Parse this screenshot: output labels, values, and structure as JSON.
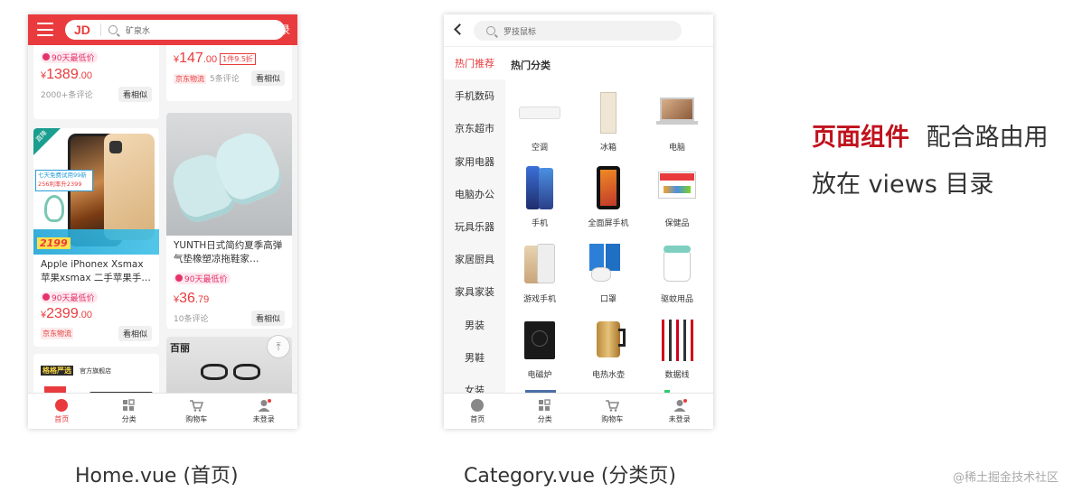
{
  "home": {
    "header": {
      "logo": "JD",
      "search_placeholder": "矿泉水",
      "login": "登录"
    },
    "cards": {
      "top_left": {
        "tag": "90天最低价",
        "price_cur": "¥",
        "price_int": "1389",
        "price_dec": ".00",
        "reviews": "2000+条评论",
        "similar": "看相似"
      },
      "top_right": {
        "price_cur": "¥",
        "price_int": "147",
        "price_dec": ".00",
        "discount": "1件9.5折",
        "logistics": "京东物流",
        "reviews": "5条评论",
        "similar": "看相似"
      },
      "iphone": {
        "corner": "直降",
        "promo": "七天免费试用99新",
        "promo2": "256利率升2399",
        "price_tag": "2199",
        "title": "Apple iPhonex Xsmax苹果xsmax 二手苹果手…",
        "tag": "90天最低价",
        "price_cur": "¥",
        "price_int": "2399",
        "price_dec": ".00",
        "logistics": "京东物流",
        "similar": "看相似"
      },
      "slippers": {
        "title": "YUNTH日式简约夏季高弹气垫橡塑凉拖鞋家…",
        "tag": "90天最低价",
        "price_cur": "¥",
        "price_int": "36",
        "price_dec": ".79",
        "reviews": "10条评论",
        "similar": "看相似"
      },
      "bottom_left": {
        "brand": "格格严选",
        "store": "官方旗舰店"
      },
      "bottom_right": {
        "brand": "百丽"
      }
    },
    "totop_icon": "top-arrow-icon",
    "tabbar": [
      {
        "label": "首页",
        "icon": "home-icon"
      },
      {
        "label": "分类",
        "icon": "category-icon"
      },
      {
        "label": "购物车",
        "icon": "cart-icon"
      },
      {
        "label": "未登录",
        "icon": "user-icon"
      }
    ]
  },
  "category": {
    "header": {
      "search_placeholder": "罗技鼠标"
    },
    "sidebar": [
      "热门推荐",
      "手机数码",
      "京东超市",
      "家用电器",
      "电脑办公",
      "玩具乐器",
      "家居厨具",
      "家具家装",
      "男装",
      "男鞋",
      "女装"
    ],
    "section_title": "热门分类",
    "items": [
      "空调",
      "冰箱",
      "电脑",
      "手机",
      "全面屏手机",
      "保健品",
      "游戏手机",
      "口罩",
      "驱蚊用品",
      "电磁炉",
      "电热水壶",
      "数据线"
    ],
    "tabbar": [
      {
        "label": "首页",
        "icon": "home-icon"
      },
      {
        "label": "分类",
        "icon": "category-icon"
      },
      {
        "label": "购物车",
        "icon": "cart-icon"
      },
      {
        "label": "未登录",
        "icon": "user-icon"
      }
    ]
  },
  "captions": {
    "home": "Home.vue (首页)",
    "category": "Category.vue (分类页)"
  },
  "side_text": {
    "highlight": "页面组件",
    "rest1": "配合路由用",
    "line2": "放在 views 目录"
  },
  "watermark": "@稀土掘金技术社区",
  "colors": {
    "jd_red": "#e93b3d",
    "highlight": "#c0121c"
  }
}
